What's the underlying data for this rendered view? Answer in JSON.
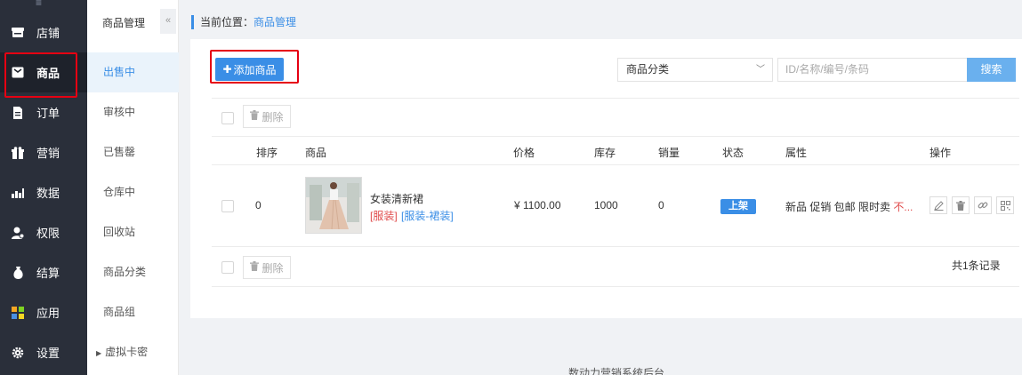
{
  "sidebar": {
    "items": [
      {
        "label": "店铺",
        "icon": "store-icon"
      },
      {
        "label": "商品",
        "icon": "goods-icon",
        "active": true
      },
      {
        "label": "订单",
        "icon": "order-icon"
      },
      {
        "label": "营销",
        "icon": "gift-icon"
      },
      {
        "label": "数据",
        "icon": "chart-icon"
      },
      {
        "label": "权限",
        "icon": "user-icon"
      },
      {
        "label": "结算",
        "icon": "moneybag-icon"
      },
      {
        "label": "应用",
        "icon": "apps-icon"
      },
      {
        "label": "设置",
        "icon": "gear-icon"
      }
    ]
  },
  "subnav": {
    "title": "商品管理",
    "collapse": "«",
    "items": [
      {
        "label": "出售中",
        "active": true
      },
      {
        "label": "审核中"
      },
      {
        "label": "已售罄"
      },
      {
        "label": "仓库中"
      },
      {
        "label": "回收站"
      },
      {
        "label": "商品分类"
      },
      {
        "label": "商品组"
      },
      {
        "label": "虚拟卡密"
      }
    ]
  },
  "breadcrumb": {
    "prefix": "当前位置：",
    "current": "商品管理"
  },
  "toolbar": {
    "add_label": "添加商品",
    "category_select": "商品分类",
    "search_placeholder": "ID/名称/编号/条码",
    "search_label": "搜索"
  },
  "bulk": {
    "delete_label": "删除"
  },
  "table": {
    "headers": [
      "排序",
      "商品",
      "价格",
      "库存",
      "销量",
      "状态",
      "属性",
      "操作"
    ],
    "rows": [
      {
        "sort": "0",
        "name": "女装清新裙",
        "tag1": "[服装]",
        "tag2": "[服装-裙装]",
        "price": "¥ 1100.00",
        "stock": "1000",
        "sales": "0",
        "status": "上架",
        "attrs": "新品 促销 包邮 限时卖",
        "attrs_more": "不..."
      }
    ]
  },
  "summary": {
    "total": "共1条记录"
  },
  "footer": {
    "text": "数动力营销系统后台"
  },
  "colors": {
    "accent": "#3a8ee6",
    "sidebar_bg": "#2a2f3a",
    "highlight_box": "#e60012",
    "danger": "#e04b4b"
  }
}
